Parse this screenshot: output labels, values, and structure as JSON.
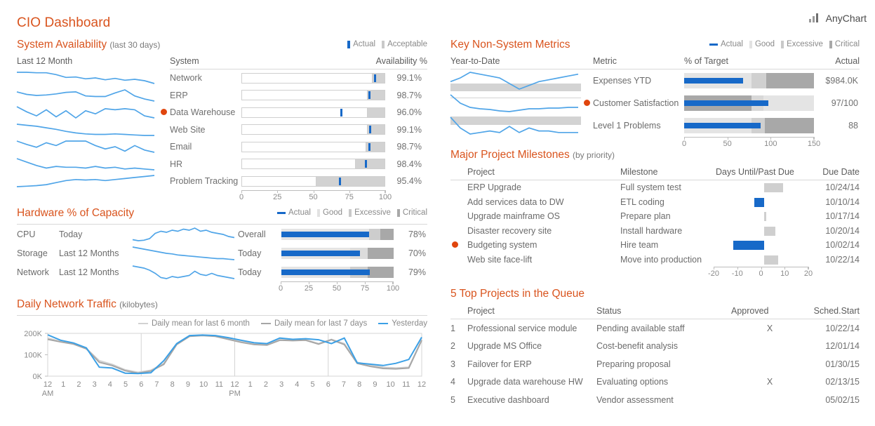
{
  "header": {
    "title": "CIO Dashboard",
    "brand": "AnyChart",
    "brand_icon": "bar-chart-icon"
  },
  "system_availability": {
    "title": "System Availability",
    "subtitle": "(last 30 days)",
    "legend": [
      {
        "label": "Actual",
        "color": "#1769c8"
      },
      {
        "label": "Acceptable",
        "color": "#c9c9c9"
      }
    ],
    "columns": {
      "spark": "Last 12 Month",
      "system": "System",
      "value": "Availability %"
    },
    "axis": {
      "min": 0,
      "max": 100,
      "ticks": [
        0,
        25,
        50,
        75,
        100
      ]
    },
    "rows": [
      {
        "system": "Network",
        "value": "99.1%",
        "actual": 93.5,
        "acceptable": 91.5,
        "alert": false,
        "spark": [
          44,
          44,
          43,
          43,
          39,
          33,
          34,
          30,
          32,
          28,
          31,
          27,
          29,
          26,
          20
        ]
      },
      {
        "system": "ERP",
        "value": "98.7%",
        "actual": 89.5,
        "acceptable": 88.0,
        "alert": false,
        "spark": [
          44,
          39,
          37,
          38,
          40,
          43,
          44,
          36,
          35,
          35,
          42,
          48,
          36,
          30,
          26
        ]
      },
      {
        "system": "Data Warehouse",
        "value": "96.0%",
        "actual": 69.5,
        "acceptable": 88.0,
        "alert": true,
        "spark": [
          42,
          32,
          24,
          36,
          22,
          34,
          20,
          34,
          28,
          38,
          36,
          38,
          36,
          24,
          20
        ]
      },
      {
        "system": "Web Site",
        "value": "99.1%",
        "actual": 90.0,
        "acceptable": 88.0,
        "alert": false,
        "spark": [
          44,
          42,
          40,
          37,
          34,
          30,
          27,
          25,
          24,
          24,
          25,
          24,
          23,
          22,
          22
        ]
      },
      {
        "system": "Email",
        "value": "98.7%",
        "actual": 89.5,
        "acceptable": 87.0,
        "alert": false,
        "spark": [
          44,
          38,
          33,
          41,
          36,
          44,
          44,
          44,
          36,
          30,
          34,
          26,
          36,
          28,
          24
        ]
      },
      {
        "system": "HR",
        "value": "98.4%",
        "actual": 87.0,
        "acceptable": 80.0,
        "alert": false,
        "spark": [
          46,
          38,
          30,
          24,
          28,
          26,
          26,
          24,
          28,
          24,
          26,
          22,
          24,
          22,
          20
        ]
      },
      {
        "system": "Problem Tracking",
        "value": "95.4%",
        "actual": 68.5,
        "acceptable": 52.0,
        "alert": false,
        "spark": [
          22,
          23,
          24,
          26,
          30,
          34,
          36,
          35,
          36,
          34,
          36,
          38,
          40,
          42,
          44
        ]
      }
    ]
  },
  "hardware": {
    "title": "Hardware % of Capacity",
    "legend": [
      {
        "label": "Actual",
        "color": "#1769c8"
      },
      {
        "label": "Good",
        "color": "#e2e2e2"
      },
      {
        "label": "Excessive",
        "color": "#c9c9c9"
      },
      {
        "label": "Critical",
        "color": "#a8a8a8"
      }
    ],
    "axis": {
      "min": 0,
      "max": 100,
      "ticks": [
        0,
        25,
        50,
        75,
        100
      ]
    },
    "rows": [
      {
        "resource": "CPU",
        "period": "Today",
        "scope": "Overall",
        "value": "78%",
        "actual": 78,
        "bands": [
          {
            "to": 78,
            "color": "#e4e4e4"
          },
          {
            "to": 88,
            "color": "#cdcdcd"
          },
          {
            "to": 100,
            "color": "#a8a8a8"
          }
        ],
        "spark": [
          8,
          6,
          7,
          10,
          20,
          24,
          22,
          26,
          24,
          28,
          26,
          30,
          24,
          26,
          22,
          20,
          18,
          14,
          12
        ]
      },
      {
        "resource": "Storage",
        "period": "Last 12 Months",
        "scope": "Today",
        "value": "70%",
        "actual": 70,
        "bands": [
          {
            "to": 61,
            "color": "#e4e4e4"
          },
          {
            "to": 77,
            "color": "#dcdcdc"
          },
          {
            "to": 100,
            "color": "#a8a8a8"
          }
        ],
        "spark": [
          30,
          28,
          26,
          24,
          22,
          20,
          18,
          17,
          15,
          14,
          13,
          12,
          11,
          10,
          9,
          8,
          8,
          7,
          6
        ]
      },
      {
        "resource": "Network",
        "period": "Last 12 Months",
        "scope": "Today",
        "value": "79%",
        "actual": 79,
        "bands": [
          {
            "to": 61,
            "color": "#e4e4e4"
          },
          {
            "to": 77,
            "color": "#cdcdcd"
          },
          {
            "to": 100,
            "color": "#a8a8a8"
          }
        ],
        "spark": [
          32,
          30,
          28,
          24,
          18,
          10,
          8,
          12,
          10,
          12,
          14,
          22,
          16,
          14,
          18,
          14,
          12,
          10,
          8
        ]
      }
    ]
  },
  "network_traffic": {
    "title": "Daily Network Traffic",
    "subtitle": "(kilobytes)",
    "legend": [
      {
        "label": "Daily mean for last 6 month",
        "color": "#d2d2d2"
      },
      {
        "label": "Daily mean for last 7 days",
        "color": "#a6a6a6"
      },
      {
        "label": "Yesterday",
        "color": "#3ba0e6"
      }
    ],
    "yticks": [
      "200K",
      "100K",
      "0K"
    ],
    "ylim": [
      0,
      200
    ],
    "xticks": [
      "12",
      "1",
      "2",
      "3",
      "4",
      "5",
      "6",
      "7",
      "8",
      "9",
      "10",
      "11",
      "12",
      "1",
      "2",
      "3",
      "4",
      "5",
      "6",
      "7",
      "8",
      "9",
      "10",
      "11",
      "12"
    ],
    "xlabel_left": "AM",
    "xlabel_mid": "PM",
    "series": [
      {
        "name": "Daily mean for last 6 month",
        "values": [
          178,
          162,
          152,
          130,
          72,
          55,
          30,
          18,
          28,
          60,
          150,
          188,
          192,
          188,
          175,
          162,
          152,
          148,
          170,
          168,
          170,
          152,
          172,
          152,
          65,
          52,
          42,
          38,
          42,
          170
        ]
      },
      {
        "name": "Daily mean for last 7 days",
        "values": [
          172,
          160,
          150,
          128,
          65,
          50,
          26,
          14,
          24,
          55,
          148,
          186,
          190,
          186,
          172,
          158,
          148,
          145,
          168,
          166,
          168,
          150,
          170,
          148,
          60,
          46,
          36,
          34,
          38,
          168
        ]
      },
      {
        "name": "Yesterday",
        "values": [
          193,
          168,
          155,
          132,
          42,
          38,
          14,
          12,
          16,
          72,
          152,
          190,
          192,
          190,
          180,
          168,
          156,
          152,
          178,
          172,
          175,
          170,
          152,
          178,
          62,
          56,
          50,
          60,
          78,
          182
        ]
      }
    ]
  },
  "key_metrics": {
    "title": "Key Non-System Metrics",
    "legend": [
      {
        "label": "Actual",
        "color": "#1769c8"
      },
      {
        "label": "Good",
        "color": "#e2e2e2"
      },
      {
        "label": "Excessive",
        "color": "#c9c9c9"
      },
      {
        "label": "Critical",
        "color": "#a8a8a8"
      }
    ],
    "columns": {
      "spark": "Year-to-Date",
      "metric": "Metric",
      "bullet": "% of Target",
      "actual": "Actual"
    },
    "axis": {
      "min": 0,
      "max": 150,
      "ticks": [
        0,
        50,
        100,
        150
      ]
    },
    "rows": [
      {
        "metric": "Expenses YTD",
        "actual": "$984.0K",
        "value": 68,
        "alert": false,
        "bands": [
          {
            "to": 78,
            "color": "#e4e4e4"
          },
          {
            "to": 95,
            "color": "#d0d0d0"
          },
          {
            "to": 150,
            "color": "#a8a8a8"
          }
        ],
        "spark": [
          22,
          26,
          32,
          30,
          28,
          26,
          20,
          14,
          18,
          22,
          24,
          26,
          28,
          30
        ],
        "spark_band": {
          "top": 62,
          "height": 38
        }
      },
      {
        "metric": "Customer Satisfaction",
        "actual": "97/100",
        "value": 97,
        "alert": true,
        "bands": [
          {
            "to": 78,
            "color": "#a8a8a8"
          },
          {
            "to": 92,
            "color": "#d8d8d8"
          },
          {
            "to": 150,
            "color": "#e4e4e4"
          }
        ],
        "spark": [
          38,
          26,
          20,
          18,
          17,
          15,
          14,
          16,
          18,
          18,
          19,
          19,
          20,
          20
        ],
        "spark_band": {
          "top": 22,
          "height": 6
        }
      },
      {
        "metric": "Level 1 Problems",
        "actual": "88",
        "value": 88,
        "alert": false,
        "bands": [
          {
            "to": 78,
            "color": "#e4e4e4"
          },
          {
            "to": 93,
            "color": "#d0d0d0"
          },
          {
            "to": 150,
            "color": "#a8a8a8"
          }
        ],
        "spark": [
          40,
          26,
          18,
          20,
          22,
          20,
          28,
          20,
          26,
          22,
          22,
          20,
          20,
          20
        ],
        "spark_band": {
          "top": 8,
          "height": 38
        }
      }
    ]
  },
  "milestones": {
    "title": "Major Project Milestones",
    "subtitle": "(by priority)",
    "columns": {
      "project": "Project",
      "milestone": "Milestone",
      "bar": "Days Until/Past Due",
      "due": "Due Date"
    },
    "axis": {
      "min": -20,
      "max": 20,
      "ticks": [
        -20,
        -10,
        0,
        10,
        20
      ]
    },
    "rows": [
      {
        "project": "ERP Upgrade",
        "milestone": "Full system test",
        "days": 8,
        "due": "10/24/14",
        "alert": false,
        "overdue": false
      },
      {
        "project": "Add services data to DW",
        "milestone": "ETL coding",
        "days": -4,
        "due": "10/10/14",
        "alert": false,
        "overdue": true
      },
      {
        "project": "Upgrade mainframe OS",
        "milestone": "Prepare plan",
        "days": 1,
        "due": "10/17/14",
        "alert": false,
        "overdue": false
      },
      {
        "project": "Disaster recovery site",
        "milestone": "Install hardware",
        "days": 5,
        "due": "10/20/14",
        "alert": false,
        "overdue": false
      },
      {
        "project": "Budgeting system",
        "milestone": "Hire team",
        "days": -13,
        "due": "10/02/14",
        "alert": true,
        "overdue": true
      },
      {
        "project": "Web site face-lift",
        "milestone": "Move into production",
        "days": 6,
        "due": "10/22/14",
        "alert": false,
        "overdue": false
      }
    ]
  },
  "queue": {
    "title": "5 Top Projects in the Queue",
    "columns": {
      "num": "",
      "project": "Project",
      "status": "Status",
      "approved": "Approved",
      "start": "Sched.Start"
    },
    "rows": [
      {
        "num": "1",
        "project": "Professional service module",
        "status": "Pending available staff",
        "approved": "X",
        "start": "10/22/14"
      },
      {
        "num": "2",
        "project": "Upgrade MS Office",
        "status": "Cost-benefit analysis",
        "approved": "",
        "start": "12/01/14"
      },
      {
        "num": "3",
        "project": "Failover for ERP",
        "status": "Preparing proposal",
        "approved": "",
        "start": "01/30/15"
      },
      {
        "num": "4",
        "project": "Upgrade data warehouse HW",
        "status": "Evaluating options",
        "approved": "X",
        "start": "02/13/15"
      },
      {
        "num": "5",
        "project": "Executive dashboard",
        "status": "Vendor assessment",
        "approved": "",
        "start": "05/02/15"
      }
    ]
  },
  "chart_data": {
    "type": "bar",
    "title": "CIO Dashboard",
    "panels": [
      {
        "name": "System Availability (last 30 days)",
        "type": "bar",
        "subtype": "bullet",
        "categories": [
          "Network",
          "ERP",
          "Data Warehouse",
          "Web Site",
          "Email",
          "HR",
          "Problem Tracking"
        ],
        "series": [
          {
            "name": "Actual",
            "values": [
              93.5,
              89.5,
              69.5,
              90.0,
              87.0,
              87.0,
              68.5
            ]
          },
          {
            "name": "Acceptable",
            "values": [
              91.5,
              88.0,
              88.0,
              88.0,
              87.0,
              80.0,
              52.0
            ]
          }
        ],
        "labels": [
          "99.1%",
          "98.7%",
          "96.0%",
          "99.1%",
          "98.7%",
          "98.4%",
          "95.4%"
        ],
        "xlabel": "",
        "ylabel": "Availability %",
        "xlim": [
          0,
          100
        ],
        "grid": false,
        "legend": "top-right"
      },
      {
        "name": "Hardware % of Capacity",
        "type": "bar",
        "subtype": "bullet",
        "categories": [
          "CPU Overall",
          "Storage Today",
          "Network Today"
        ],
        "series": [
          {
            "name": "Actual",
            "values": [
              78,
              70,
              79
            ]
          }
        ],
        "labels": [
          "78%",
          "70%",
          "79%"
        ],
        "xlim": [
          0,
          100
        ],
        "grid": false,
        "legend": "top-right"
      },
      {
        "name": "Daily Network Traffic (kilobytes)",
        "type": "line",
        "x": [
          "12 AM",
          "1",
          "2",
          "3",
          "4",
          "5",
          "6",
          "7",
          "8",
          "9",
          "10",
          "11",
          "12 PM",
          "1",
          "2",
          "3",
          "4",
          "5",
          "6",
          "7",
          "8",
          "9",
          "10",
          "11",
          "12"
        ],
        "series": [
          {
            "name": "Daily mean for last 6 month",
            "values": [
              178,
              162,
              152,
              130,
              72,
              55,
              30,
              18,
              28,
              60,
              150,
              188,
              192,
              188,
              175,
              162,
              152,
              148,
              170,
              168,
              170,
              152,
              172,
              152,
              65,
              52,
              42,
              38,
              42,
              170
            ]
          },
          {
            "name": "Daily mean for last 7 days",
            "values": [
              172,
              160,
              150,
              128,
              65,
              50,
              26,
              14,
              24,
              55,
              148,
              186,
              190,
              186,
              172,
              158,
              148,
              145,
              168,
              166,
              168,
              150,
              170,
              148,
              60,
              46,
              36,
              34,
              38,
              168
            ]
          },
          {
            "name": "Yesterday",
            "values": [
              193,
              168,
              155,
              132,
              42,
              38,
              14,
              12,
              16,
              72,
              152,
              190,
              192,
              190,
              180,
              168,
              156,
              152,
              178,
              172,
              175,
              170,
              152,
              178,
              62,
              56,
              50,
              60,
              78,
              182
            ]
          }
        ],
        "ylabel": "kilobytes",
        "ylim": [
          0,
          200
        ],
        "yticks": [
          0,
          100,
          200
        ],
        "grid": true,
        "legend": "top"
      },
      {
        "name": "Key Non-System Metrics",
        "type": "bar",
        "subtype": "bullet",
        "categories": [
          "Expenses YTD",
          "Customer Satisfaction",
          "Level 1 Problems"
        ],
        "series": [
          {
            "name": "Actual (% of target)",
            "values": [
              68,
              97,
              88
            ]
          }
        ],
        "labels": [
          "$984.0K",
          "97/100",
          "88"
        ],
        "xlim": [
          0,
          150
        ],
        "xticks": [
          0,
          50,
          100,
          150
        ],
        "grid": false,
        "legend": "top-right"
      },
      {
        "name": "Major Project Milestones (by priority)",
        "type": "bar",
        "subtype": "diverging",
        "categories": [
          "ERP Upgrade",
          "Add services data to DW",
          "Upgrade mainframe OS",
          "Disaster recovery site",
          "Budgeting system",
          "Web site face-lift"
        ],
        "values": [
          8,
          -4,
          1,
          5,
          -13,
          6
        ],
        "xlabel": "Days Until/Past Due",
        "xlim": [
          -20,
          20
        ],
        "xticks": [
          -20,
          -10,
          0,
          10,
          20
        ],
        "grid": false
      }
    ]
  }
}
